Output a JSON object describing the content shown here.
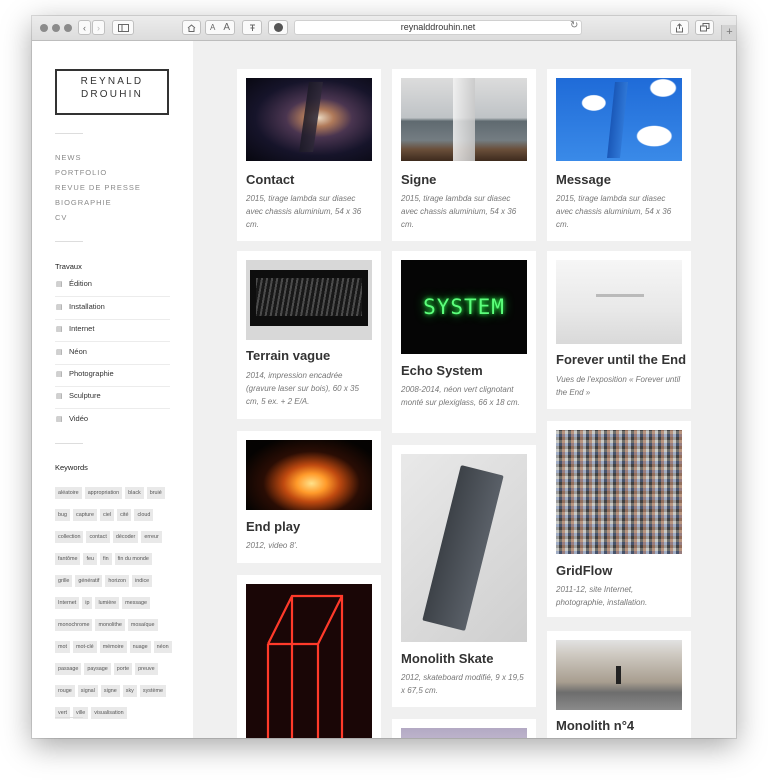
{
  "browser": {
    "url": "reynalddrouhin.net",
    "text_size_small": "A",
    "text_size_large": "A",
    "new_tab": "+"
  },
  "sidebar": {
    "logo": {
      "line1": "REYNALD",
      "line2": "DROUHIN"
    },
    "nav": [
      "NEWS",
      "PORTFOLIO",
      "REVUE DE PRESSE",
      "BIOGRAPHIE",
      "CV"
    ],
    "works_title": "Travaux",
    "works": [
      "Édition",
      "Installation",
      "Internet",
      "Néon",
      "Photographie",
      "Sculpture",
      "Vidéo"
    ],
    "keywords_title": "Keywords",
    "keywords": [
      "aléatoire",
      "appropriation",
      "black",
      "bruié",
      "bug",
      "capture",
      "ciel",
      "cité",
      "cloud",
      "collection",
      "contact",
      "décoder",
      "erreur",
      "fantôme",
      "feu",
      "fin",
      "fin du monde",
      "grille",
      "génératif",
      "horizon",
      "indice",
      "Internet",
      "ip",
      "lumière",
      "message",
      "monochrome",
      "monolithe",
      "mosaïque",
      "mot",
      "mot-clé",
      "mémoire",
      "nuage",
      "néon",
      "passage",
      "paysage",
      "porte",
      "preuve",
      "rouge",
      "signal",
      "signe",
      "sky",
      "système",
      "vert",
      "ville",
      "visualisation"
    ]
  },
  "cards": [
    {
      "title": "Contact",
      "desc": "2015, tirage lambda sur diasec avec chassis aluminium, 54 x 36 cm."
    },
    {
      "title": "Signe",
      "desc": "2015, tirage lambda sur diasec avec chassis aluminium, 54 x 36 cm."
    },
    {
      "title": "Message",
      "desc": "2015, tirage lambda sur diasec avec chassis aluminium, 54 x 36 cm."
    },
    {
      "title": "Terrain vague",
      "desc": "2014, impression encadrée (gravure laser sur bois), 60 x 35 cm, 5 ex. + 2 E/A."
    },
    {
      "title": "Echo System",
      "desc": "2008-2014, néon vert clignotant monté sur plexiglass, 66 x 18 cm.",
      "sign_text": "SYSTEM"
    },
    {
      "title": "Forever until the End",
      "desc": "Vues de l'exposition « Forever until the End »"
    },
    {
      "title": "End play",
      "desc": "2012, video 8'."
    },
    {
      "title": "Monolith Skate",
      "desc": "2012, skateboard modifié, 9 x 19,5 x 67,5 cm."
    },
    {
      "title": "GridFlow",
      "desc": "2011-12, site Internet, photographie, installation."
    },
    {
      "title": "Monolith n°4",
      "desc": ""
    }
  ]
}
